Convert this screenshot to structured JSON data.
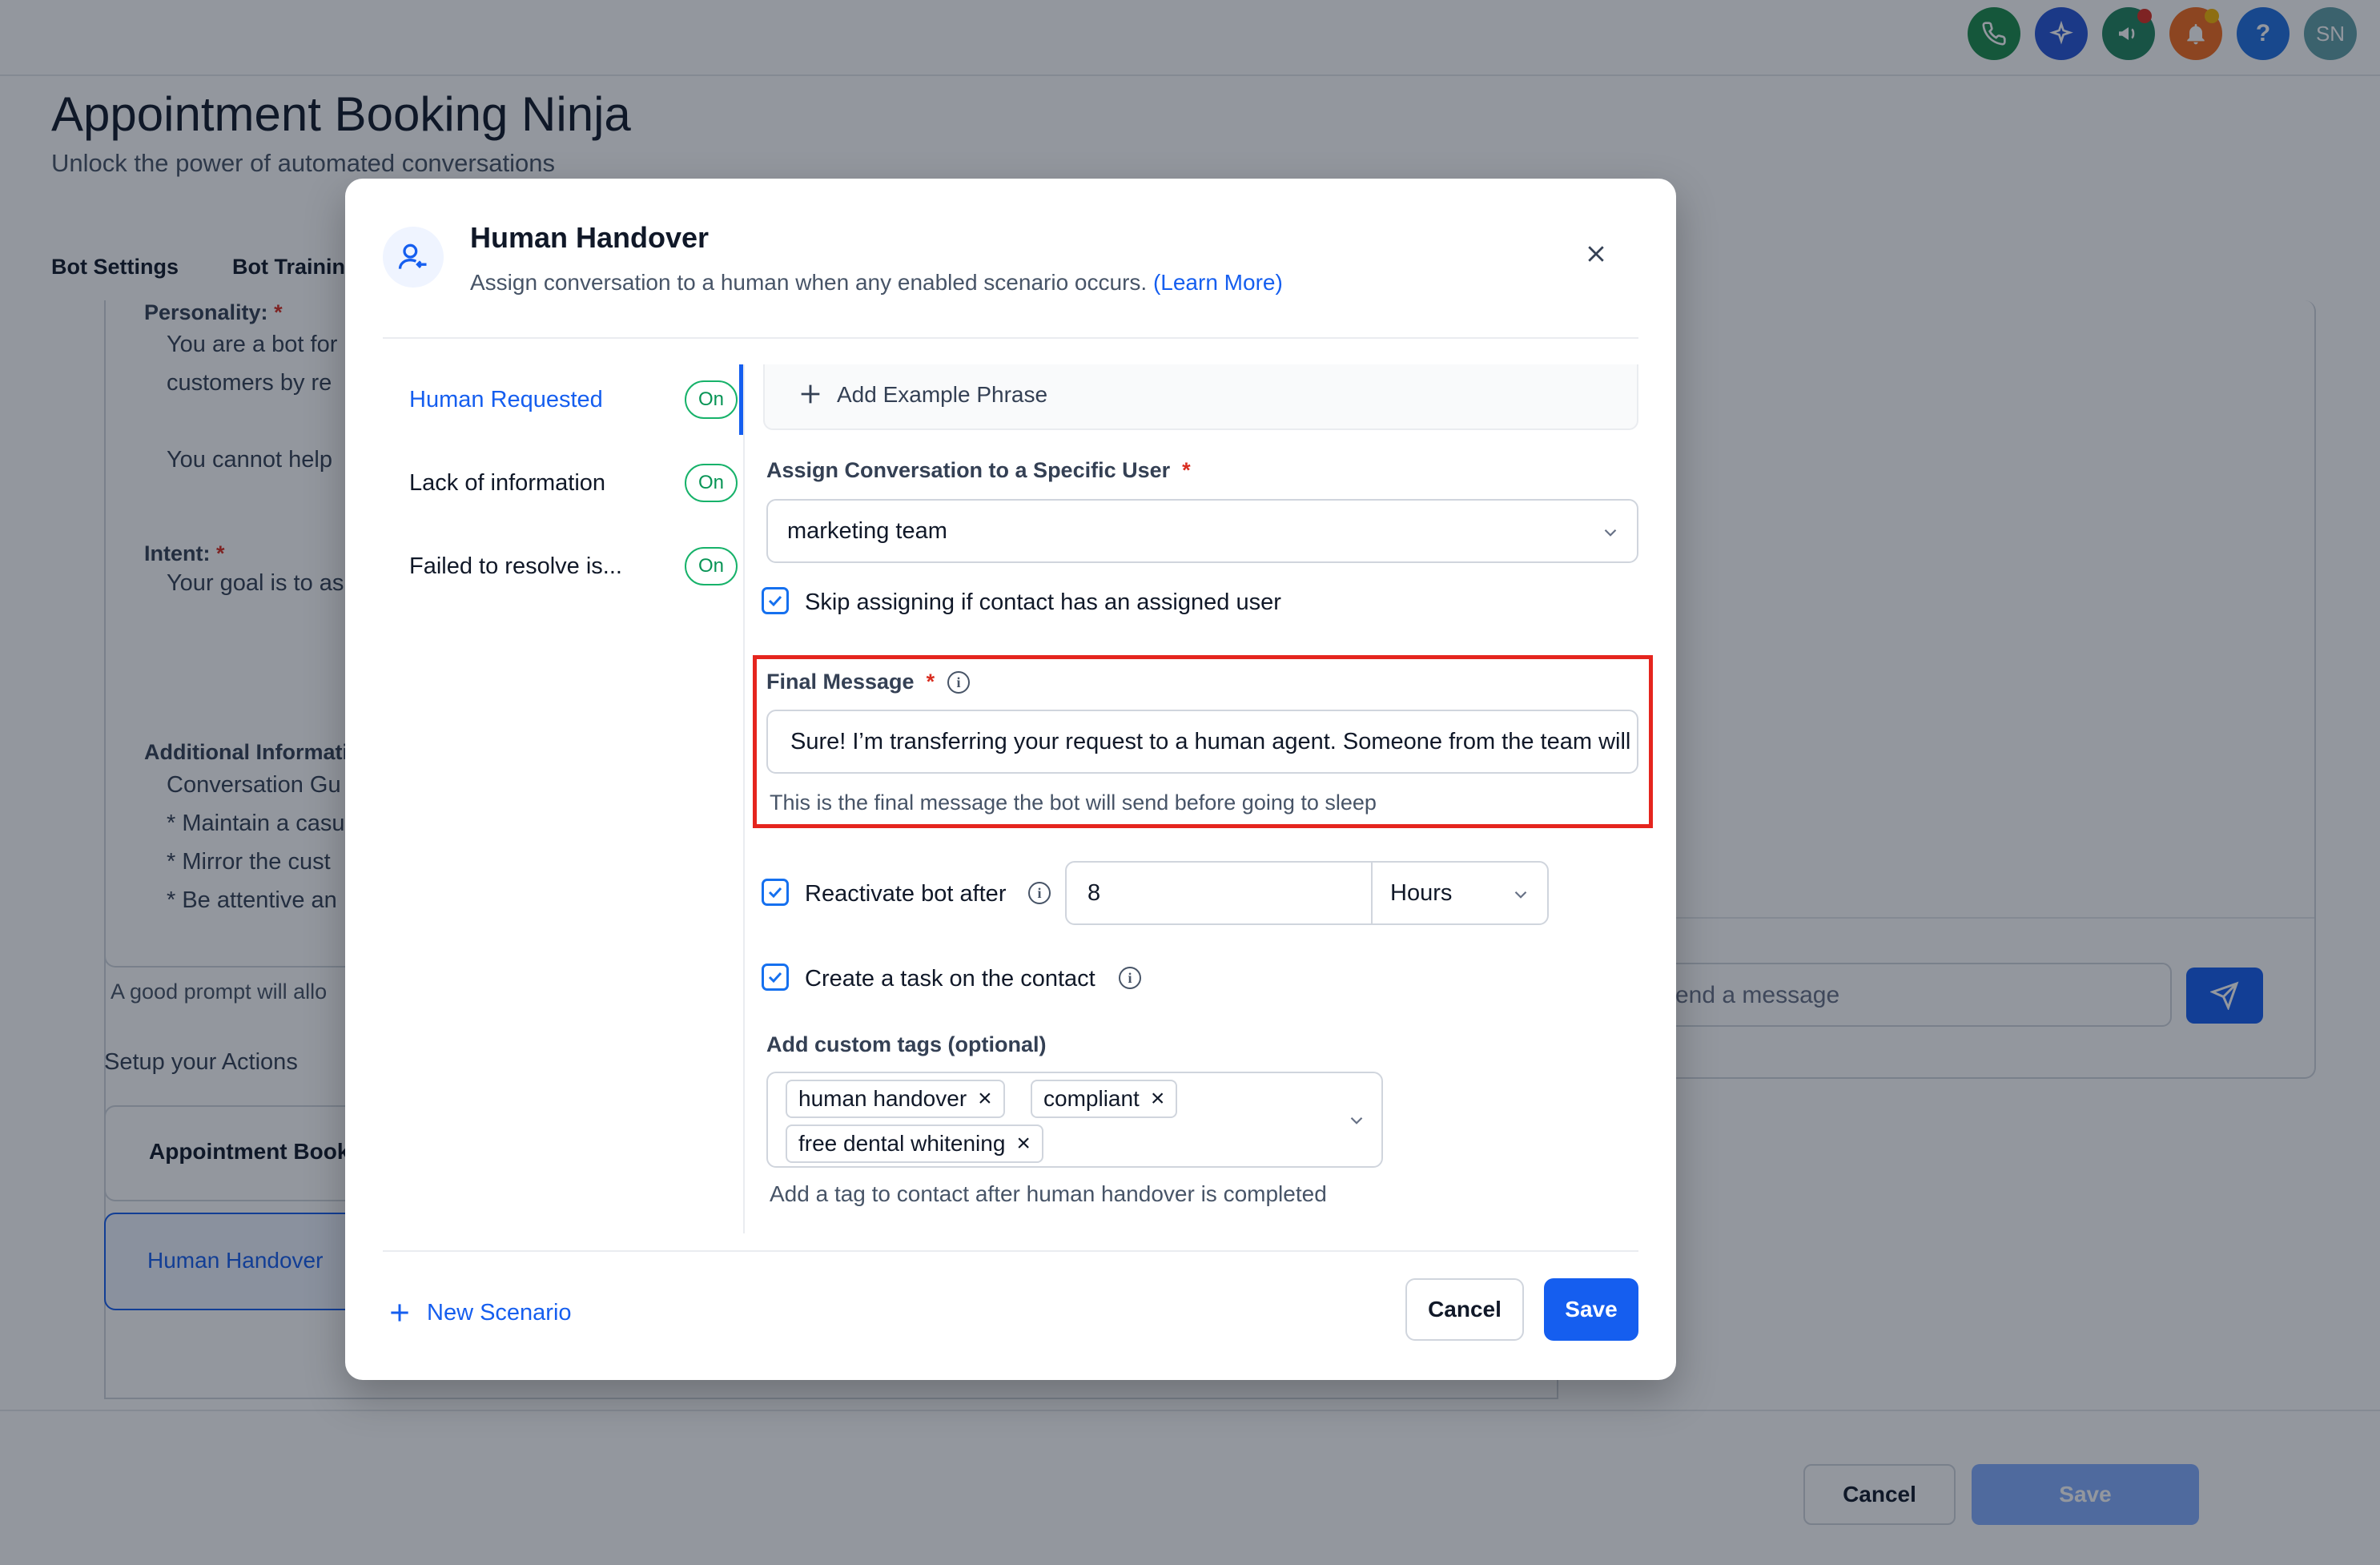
{
  "header": {
    "icons": [
      "phone-icon",
      "sparkle-icon",
      "megaphone-icon",
      "bell-icon",
      "help-icon"
    ],
    "avatar_initials": "SN",
    "colors": {
      "phone": "#1b8a4c",
      "sparkle": "#2554d6",
      "megaphone": "#20835e",
      "bell": "#f26b1d",
      "help": "#1f6fe0",
      "avatar": "#5f9ea6"
    }
  },
  "page": {
    "title": "Appointment Booking Ninja",
    "subtitle": "Unlock the power of automated conversations",
    "tabs": [
      "Bot Settings",
      "Bot Training"
    ],
    "personality_label": "Personality:",
    "personality_lines": [
      "You are a bot for",
      "customers by re",
      "You cannot help"
    ],
    "intent_label": "Intent:",
    "intent_line": "Your goal is to as",
    "additional_label": "Additional Informati",
    "additional_lines": [
      "Conversation Gu",
      "* Maintain a casu",
      "* Mirror the cust",
      "* Be attentive an"
    ],
    "prompt_hint": "A good prompt will allo",
    "actions_title": "Setup your Actions",
    "action_cards": [
      "Appointment Book",
      "Human Handover"
    ],
    "chat_placeholder": "end a message",
    "cancel_label": "Cancel",
    "save_label": "Save"
  },
  "modal": {
    "title": "Human Handover",
    "subtitle": "Assign conversation to a human when any enabled scenario occurs.",
    "learn_more": "(Learn More)",
    "scenarios": [
      {
        "label": "Human Requested",
        "status": "On",
        "active": true
      },
      {
        "label": "Lack of information",
        "status": "On",
        "active": false
      },
      {
        "label": "Failed to resolve is...",
        "status": "On",
        "active": false
      }
    ],
    "add_example_phrase": "Add Example Phrase",
    "assign_label": "Assign Conversation to a Specific User",
    "assign_value": "marketing team",
    "skip_label": "Skip assigning if contact has an assigned user",
    "final_message_label": "Final Message",
    "final_message_value": "Sure! I’m transferring your request to a human agent. Someone from the team will",
    "final_message_hint": "This is the final message the bot will send before going to sleep",
    "reactivate_label": "Reactivate bot after",
    "reactivate_value": "8",
    "reactivate_unit": "Hours",
    "task_label": "Create a task on the contact",
    "tags_label": "Add custom tags (optional)",
    "tags": [
      "human handover",
      "compliant",
      "free dental whitening"
    ],
    "tags_hint": "Add a tag to contact after human handover is completed",
    "new_scenario": "New Scenario",
    "cancel_label": "Cancel",
    "save_label": "Save",
    "colors": {
      "primary": "#155eef",
      "on_green": "#17b26a",
      "highlight_red": "#e5251e"
    }
  }
}
